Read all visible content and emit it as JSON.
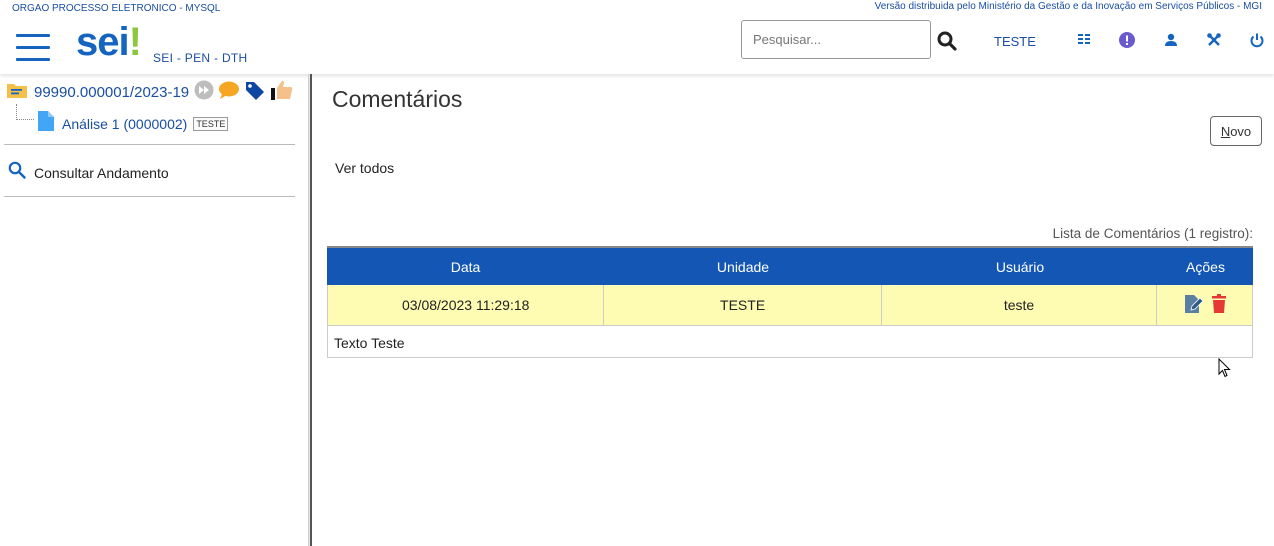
{
  "header": {
    "org_name": "ORGAO PROCESSO ELETRONICO - MYSQL",
    "version_text": "Versão distribuida pelo Ministério da Gestão e da Inovação em Serviços Públicos - MGI",
    "logo": "sei",
    "logo_accent": "!",
    "subsystem": "SEI - PEN - DTH",
    "search_placeholder": "Pesquisar...",
    "unit": "TESTE",
    "icons": [
      "menu-icon",
      "search-icon",
      "grid-icon",
      "alert-icon",
      "user-icon",
      "tools-icon",
      "power-icon"
    ],
    "accent_color": "#1565c0"
  },
  "tree": {
    "process_number": "99990.000001/2023-19",
    "document_label": "Análise 1 (0000002)",
    "document_tag": "TESTE",
    "consult_label": "Consultar Andamento"
  },
  "main": {
    "title": "Comentários",
    "new_button_first": "N",
    "new_button_rest": "ovo",
    "view_all": "Ver todos",
    "caption": "Lista de Comentários (1 registro):",
    "columns": [
      "Data",
      "Unidade",
      "Usuário",
      "Ações"
    ],
    "rows": [
      {
        "data": "03/08/2023 11:29:18",
        "unidade": "TESTE",
        "usuario": "teste",
        "texto": "Texto Teste"
      }
    ],
    "header_color": "#1456b3",
    "row_color": "#fefcb2"
  }
}
